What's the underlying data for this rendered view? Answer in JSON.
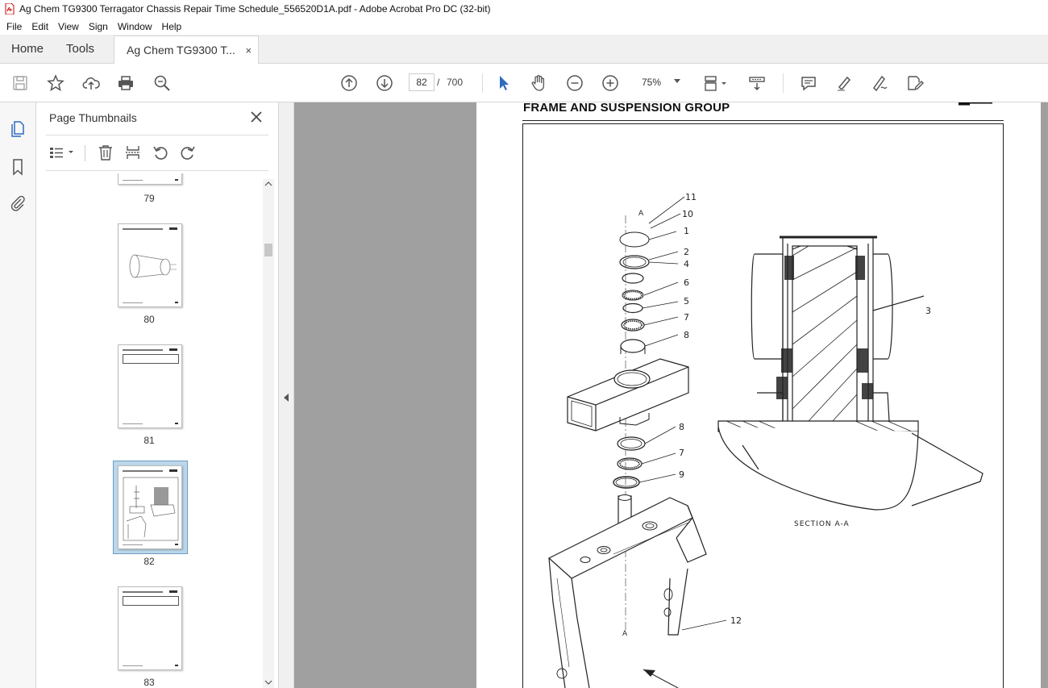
{
  "window": {
    "title": "Ag Chem TG9300 Terragator Chassis Repair Time Schedule_556520D1A.pdf - Adobe Acrobat Pro DC (32-bit)"
  },
  "menu": [
    "File",
    "Edit",
    "View",
    "Sign",
    "Window",
    "Help"
  ],
  "tabs": {
    "home": "Home",
    "tools": "Tools",
    "document": "Ag Chem TG9300 T...",
    "close": "×"
  },
  "toolbar": {
    "current_page": "82",
    "separator": "/",
    "total_pages": "700",
    "zoom": "75%"
  },
  "panel": {
    "title": "Page Thumbnails",
    "thumbnails": [
      {
        "label": "79"
      },
      {
        "label": "80"
      },
      {
        "label": "81"
      },
      {
        "label": "82",
        "selected": true
      },
      {
        "label": "83"
      }
    ]
  },
  "page": {
    "heading": "FRAME AND SUSPENSION GROUP",
    "part_labels": [
      "11",
      "10",
      "1",
      "2",
      "4",
      "6",
      "5",
      "7",
      "8",
      "8",
      "7",
      "9",
      "12",
      "3"
    ],
    "section_label": "SECTION  A-A",
    "section_marks": [
      "A",
      "A"
    ]
  },
  "colors": {
    "accent": "#2d6cc0",
    "selected_thumb": "#bcd7ea",
    "doc_background": "#a0a0a0"
  }
}
